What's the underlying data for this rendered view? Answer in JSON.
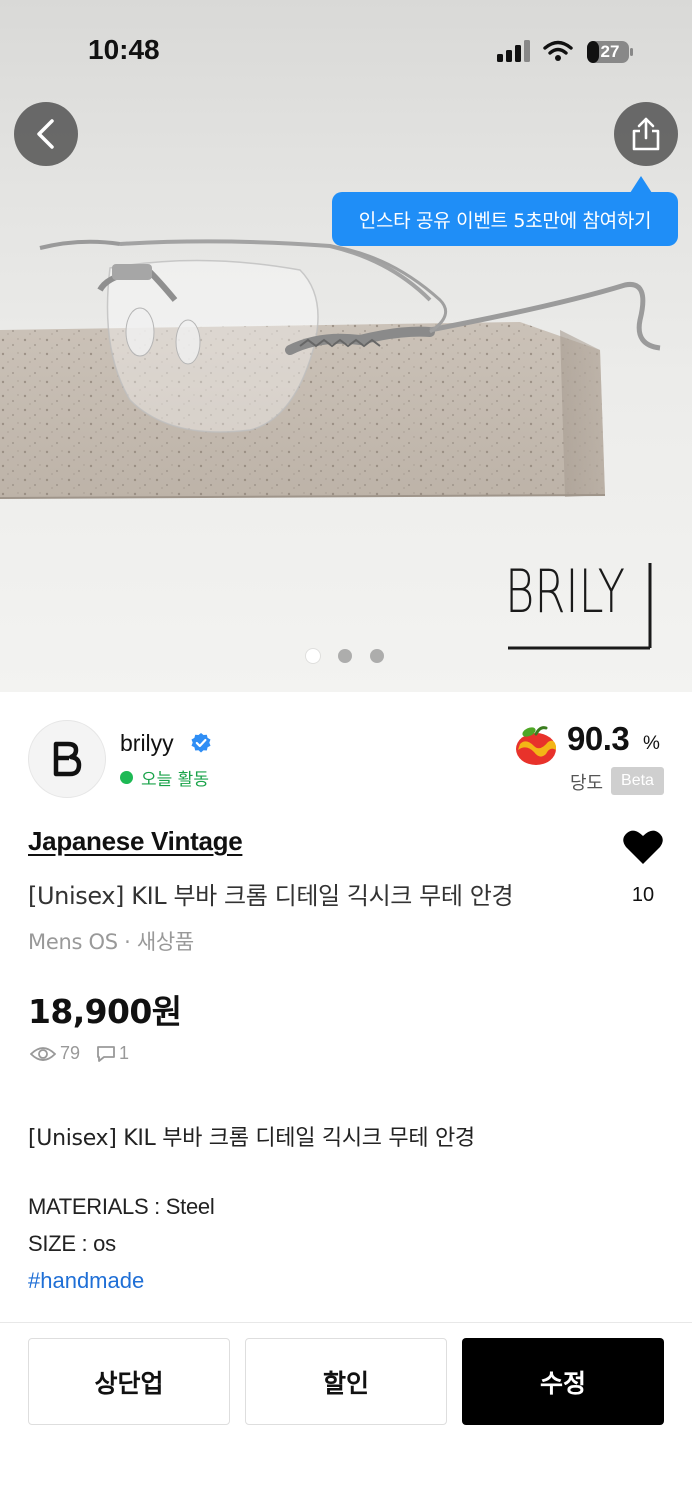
{
  "status_bar": {
    "time": "10:48",
    "battery": "27"
  },
  "hero": {
    "watermark": "BRILY",
    "share_tooltip": "인스타 공유 이벤트 5초만에 참여하기",
    "page_count": 3,
    "active_page": 1
  },
  "seller": {
    "avatar_letter": "B",
    "name": "brilyy",
    "activity": "오늘 활동"
  },
  "sweetness": {
    "value": "90.3",
    "unit": "%",
    "label": "당도",
    "badge": "Beta"
  },
  "product": {
    "brand": "Japanese Vintage",
    "title": "[Unisex] KIL 부바 크롬 디테일 긱시크 무테 안경",
    "meta": "Mens OS · 새상품",
    "price": "18,900원",
    "likes": "10",
    "views": "79",
    "comments": "1"
  },
  "description": {
    "line1": "[Unisex] KIL 부바 크롬 디테일 긱시크 무테 안경",
    "materials": "MATERIALS : Steel",
    "size": "SIZE : os",
    "hashtag": "#handmade"
  },
  "actions": {
    "bump": "상단업",
    "discount": "할인",
    "edit": "수정"
  },
  "colors": {
    "tooltip": "#1f8ef7",
    "activity_green": "#1db954",
    "hashtag_blue": "#1f6fd6",
    "primary_button": "#000000"
  }
}
